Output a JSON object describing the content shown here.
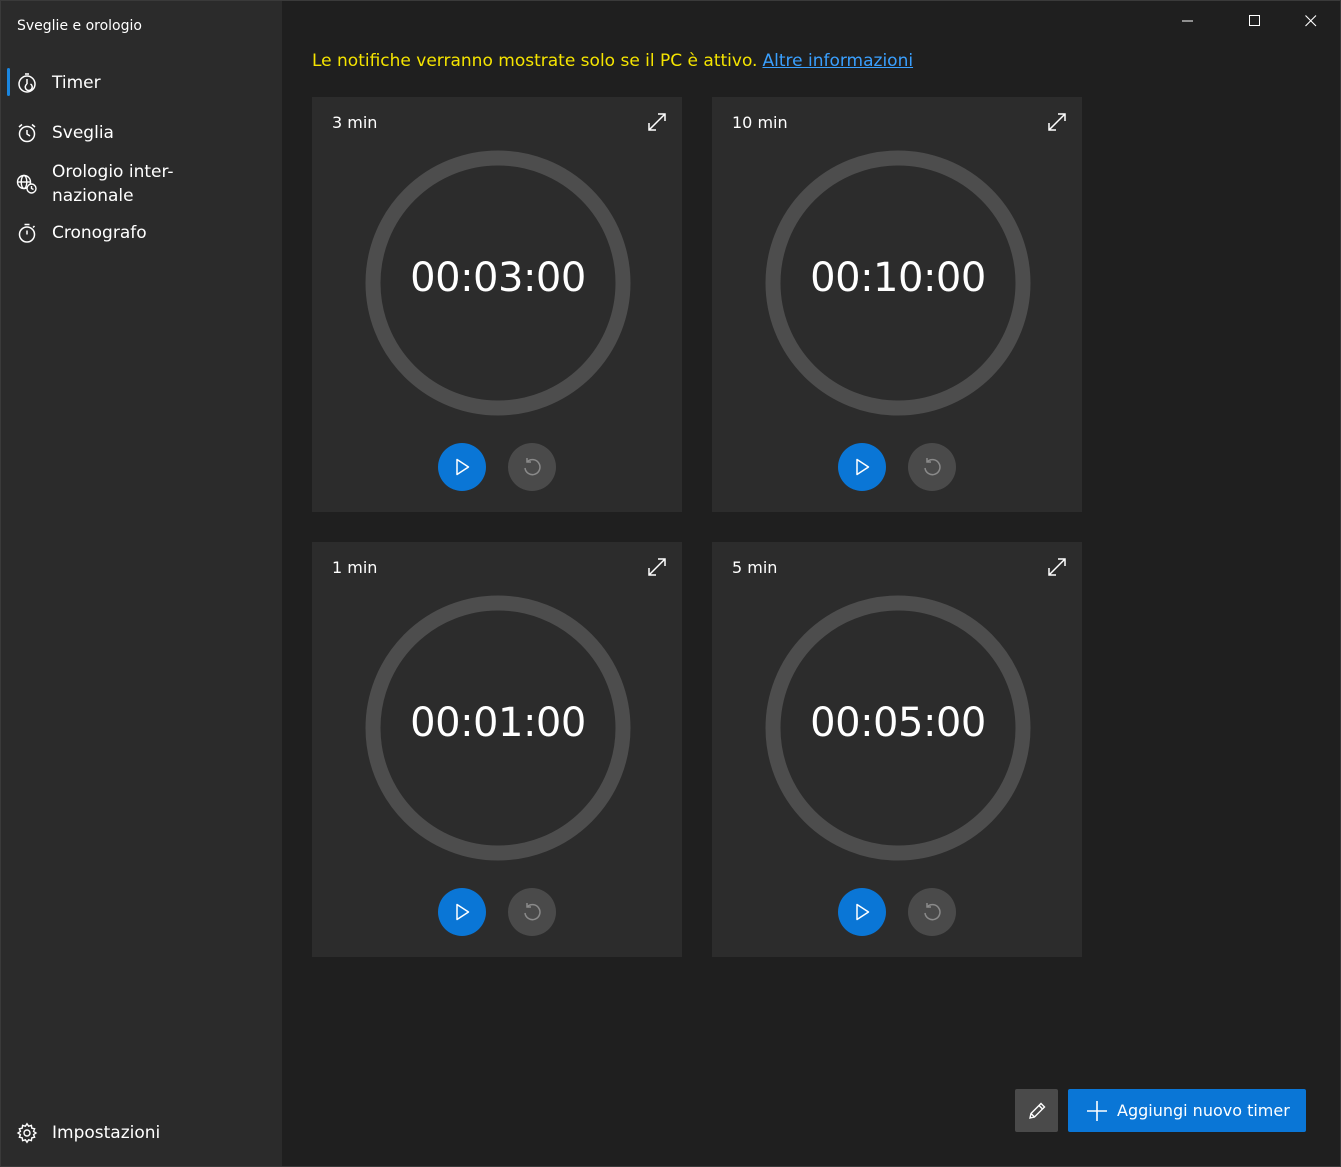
{
  "app": {
    "title": "Sveglie e orologio"
  },
  "window_controls": {
    "minimize": "minimize-icon",
    "maximize": "maximize-icon",
    "close": "close-icon"
  },
  "sidebar": {
    "items": [
      {
        "label": "Timer",
        "icon": "timer-icon",
        "selected": true
      },
      {
        "label": "Sveglia",
        "icon": "alarm-icon",
        "selected": false
      },
      {
        "label_line1": "Orologio inter-",
        "label_line2": "nazionale",
        "icon": "world-clock-icon",
        "selected": false
      },
      {
        "label": "Cronografo",
        "icon": "stopwatch-icon",
        "selected": false
      }
    ],
    "settings": {
      "label": "Impostazioni",
      "icon": "gear-icon"
    }
  },
  "notice": {
    "text": "Le notifiche verranno mostrate solo se il PC è attivo.",
    "link": "Altre informazioni",
    "text_color": "#f5e400",
    "link_color": "#3aa0ff"
  },
  "timers": [
    {
      "name": "3 min",
      "time": "00:03:00"
    },
    {
      "name": "10 min",
      "time": "00:10:00"
    },
    {
      "name": "1 min",
      "time": "00:01:00"
    },
    {
      "name": "5 min",
      "time": "00:05:00"
    }
  ],
  "actions": {
    "edit_icon": "pencil-icon",
    "add_label": "Aggiungi nuovo timer",
    "accent": "#0a76d6"
  }
}
